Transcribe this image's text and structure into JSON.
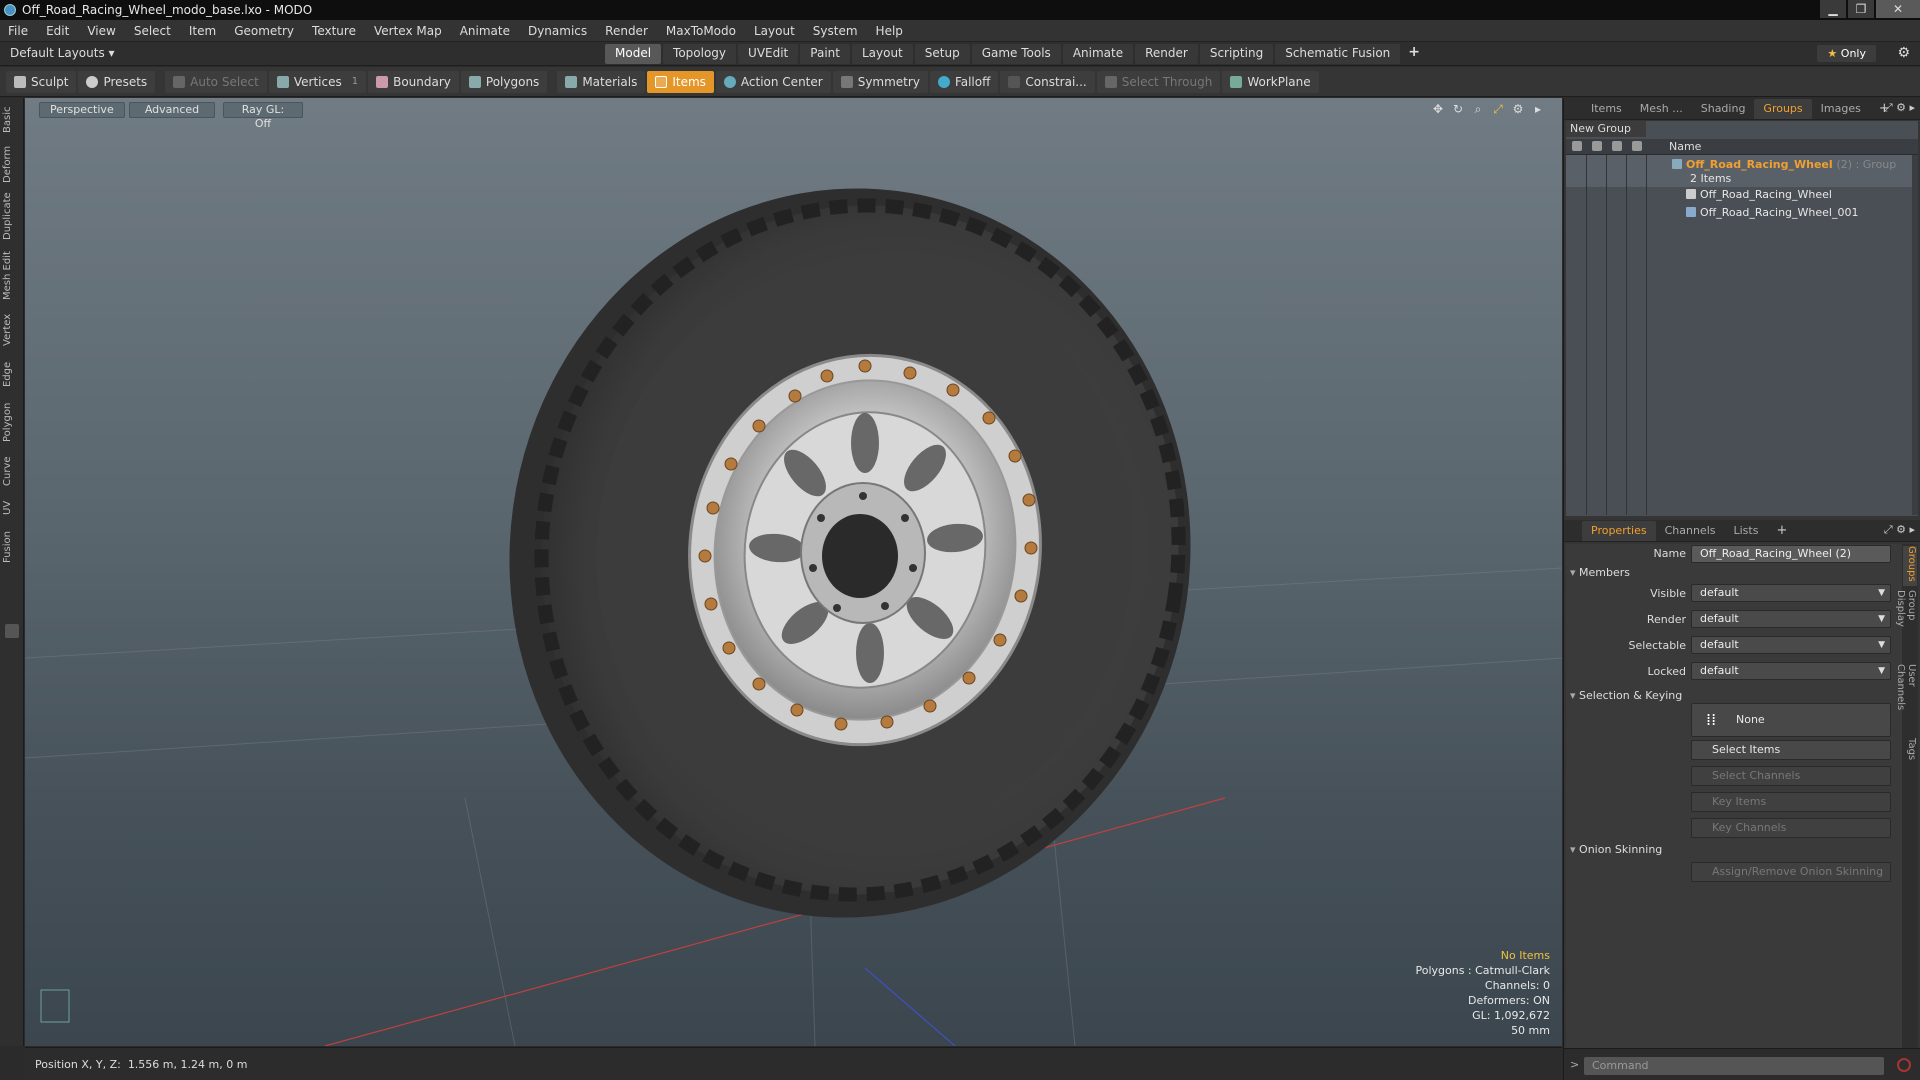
{
  "window": {
    "title": "Off_Road_Racing_Wheel_modo_base.lxo - MODO",
    "min_glyph": "▁",
    "max_glyph": "❐",
    "close_glyph": "✕"
  },
  "menu": [
    "File",
    "Edit",
    "View",
    "Select",
    "Item",
    "Geometry",
    "Texture",
    "Vertex Map",
    "Animate",
    "Dynamics",
    "Render",
    "MaxToModo",
    "Layout",
    "System",
    "Help"
  ],
  "layoutbar": {
    "layouts_label": "Default Layouts ▾",
    "tabs": [
      "Model",
      "Topology",
      "UVEdit",
      "Paint",
      "Layout",
      "Setup",
      "Game Tools",
      "Animate",
      "Render",
      "Scripting",
      "Schematic Fusion"
    ],
    "active_tab": "Model",
    "plus": "+",
    "only_star": "★",
    "only_label": "Only",
    "gear": "⚙"
  },
  "toolbar": {
    "sculpt": "Sculpt",
    "presets": "Presets",
    "auto_select": "Auto Select",
    "vertices": "Vertices",
    "vertices_count": "1",
    "boundary": "Boundary",
    "polygons": "Polygons",
    "materials": "Materials",
    "items": "Items",
    "action_center": "Action Center",
    "symmetry": "Symmetry",
    "falloff": "Falloff",
    "constraints": "Constrai...",
    "select_through": "Select Through",
    "workplane": "WorkPlane"
  },
  "lefttabs": [
    "Basic",
    "Deform",
    "Duplicate",
    "Mesh Edit",
    "Vertex",
    "Edge",
    "Polygon",
    "Curve",
    "UV",
    "Fusion"
  ],
  "viewport": {
    "perspective": "Perspective",
    "advanced": "Advanced",
    "raygl": "Ray GL: Off",
    "hud": {
      "no_items": "No Items",
      "polygons": "Polygons : Catmull-Clark",
      "channels": "Channels: 0",
      "deformers": "Deformers: ON",
      "gl": "GL: 1,092,672",
      "focal": "50 mm"
    },
    "icons": [
      "move-icon",
      "rotate-icon",
      "zoom-icon",
      "fit-icon",
      "settings-icon",
      "expand-icon"
    ]
  },
  "status": {
    "position_label": "Position X, Y, Z:",
    "position_value": "1.556 m, 1.24 m, 0 m"
  },
  "top_panel": {
    "tabs": [
      "Items",
      "Mesh ...",
      "Shading",
      "Groups",
      "Images"
    ],
    "active": "Groups",
    "plus": "+",
    "new_group": "New Group",
    "name_header": "Name",
    "group_name": "Off_Road_Racing_Wheel",
    "group_suffix": "(2) : Group",
    "item_count": "2 Items",
    "items": [
      "Off_Road_Racing_Wheel",
      "Off_Road_Racing_Wheel_001"
    ]
  },
  "properties": {
    "tabs": [
      "Properties",
      "Channels",
      "Lists"
    ],
    "active": "Properties",
    "plus": "+",
    "name_label": "Name",
    "name_value": "Off_Road_Racing_Wheel (2)",
    "members": "Members",
    "fields": [
      {
        "label": "Visible",
        "value": "default"
      },
      {
        "label": "Render",
        "value": "default"
      },
      {
        "label": "Selectable",
        "value": "default"
      },
      {
        "label": "Locked",
        "value": "default"
      }
    ],
    "selection_keying": "Selection & Keying",
    "none_label": "None",
    "select_items": "Select Items",
    "select_channels": "Select Channels",
    "key_items": "Key Items",
    "key_channels": "Key Channels",
    "onion_skinning": "Onion Skinning",
    "assign_onion": "Assign/Remove Onion Skinning",
    "side_tabs": [
      "Groups",
      "Group Display",
      "User Channels",
      "Tags"
    ]
  },
  "command": {
    "placeholder": "Command",
    "prompt": ">"
  }
}
